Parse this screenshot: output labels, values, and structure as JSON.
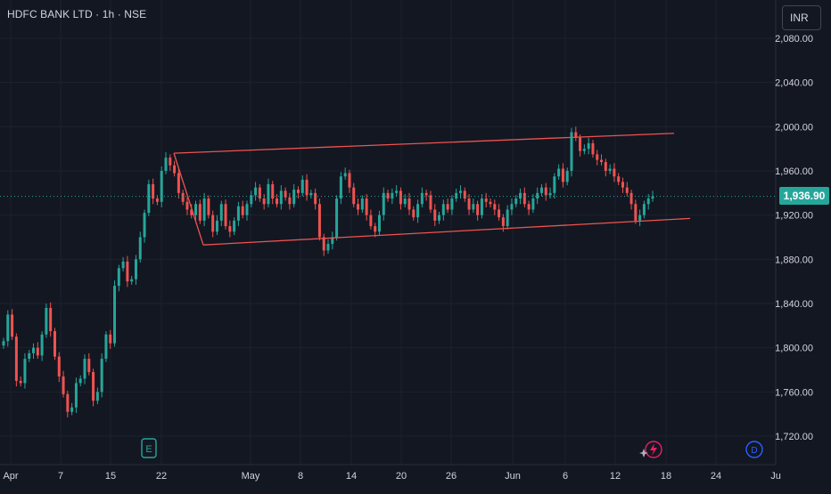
{
  "header": {
    "title": "HDFC BANK LTD · 1h · NSE"
  },
  "currency": {
    "label": "INR"
  },
  "last_price": {
    "label": "1,936.90",
    "value": 1936.9,
    "color": "#26a69a"
  },
  "markers": [
    {
      "label": "E",
      "kind": "earnings",
      "color": "#26a69a",
      "x_label": "20"
    },
    {
      "label": "D",
      "kind": "dividend",
      "color": "#2962ff",
      "x_label": "28"
    }
  ],
  "icons": {
    "flash": "flash-icon",
    "sparkle": "sparkle-icon"
  },
  "colors": {
    "up": "#26a69a",
    "down": "#ef5350",
    "channel": "#ef5350",
    "background": "#131722",
    "text": "#d1d4dc"
  },
  "chart_data": {
    "type": "candlestick",
    "title": "HDFC BANK LTD · 1h · NSE",
    "ylim": [
      1700,
      2100
    ],
    "y_ticks": [
      {
        "value": 1720,
        "label": "1,720.00"
      },
      {
        "value": 1760,
        "label": "1,760.00"
      },
      {
        "value": 1800,
        "label": "1,800.00"
      },
      {
        "value": 1840,
        "label": "1,840.00"
      },
      {
        "value": 1880,
        "label": "1,880.00"
      },
      {
        "value": 1920,
        "label": "1,920.00"
      },
      {
        "value": 1960,
        "label": "1,960.00"
      },
      {
        "value": 2000,
        "label": "2,000.00"
      },
      {
        "value": 2040,
        "label": "2,040.00"
      },
      {
        "value": 2080,
        "label": "2,080.00"
      }
    ],
    "x_ticks": [
      "Apr",
      "7",
      "15",
      "22",
      "May",
      "8",
      "14",
      "20",
      "26",
      "Jun",
      "6",
      "12",
      "18",
      "24",
      "Ju"
    ],
    "grid": true,
    "series": [
      {
        "points": [
          1806,
          1830,
          1810,
          1770,
          1768,
          1790,
          1795,
          1800,
          1793,
          1812,
          1836,
          1815,
          1792,
          1774,
          1758,
          1742,
          1746,
          1768,
          1772,
          1790,
          1778,
          1752,
          1760,
          1790,
          1812,
          1804,
          1856,
          1872,
          1878,
          1860,
          1862,
          1880,
          1900,
          1922,
          1948,
          1935,
          1932,
          1960,
          1972,
          1965,
          1958,
          1940,
          1932,
          1925,
          1920,
          1930,
          1915,
          1935,
          1920,
          1905,
          1915,
          1930,
          1910,
          1905,
          1915,
          1928,
          1920,
          1930,
          1938,
          1945,
          1935,
          1930,
          1948,
          1935,
          1930,
          1942,
          1936,
          1930,
          1943,
          1940,
          1952,
          1938,
          1940,
          1930,
          1900,
          1888,
          1894,
          1900,
          1935,
          1955,
          1958,
          1945,
          1930,
          1925,
          1935,
          1920,
          1910,
          1905,
          1920,
          1940,
          1935,
          1940,
          1942,
          1930,
          1935,
          1925,
          1918,
          1930,
          1940,
          1938,
          1925,
          1915,
          1920,
          1930,
          1925,
          1935,
          1940,
          1942,
          1935,
          1925,
          1930,
          1920,
          1935,
          1932,
          1930,
          1925,
          1918,
          1910,
          1925,
          1930,
          1935,
          1940,
          1930,
          1925,
          1935,
          1940,
          1945,
          1938,
          1940,
          1955,
          1962,
          1950,
          1960,
          1995,
          1990,
          1978,
          1980,
          1985,
          1975,
          1970,
          1968,
          1960,
          1962,
          1955,
          1950,
          1945,
          1940,
          1930,
          1915,
          1920,
          1930,
          1935,
          1937
        ]
      }
    ],
    "annotations": [
      {
        "type": "channel",
        "upper": [
          1976,
          1994
        ],
        "lower": [
          1893,
          1917
        ]
      }
    ]
  }
}
